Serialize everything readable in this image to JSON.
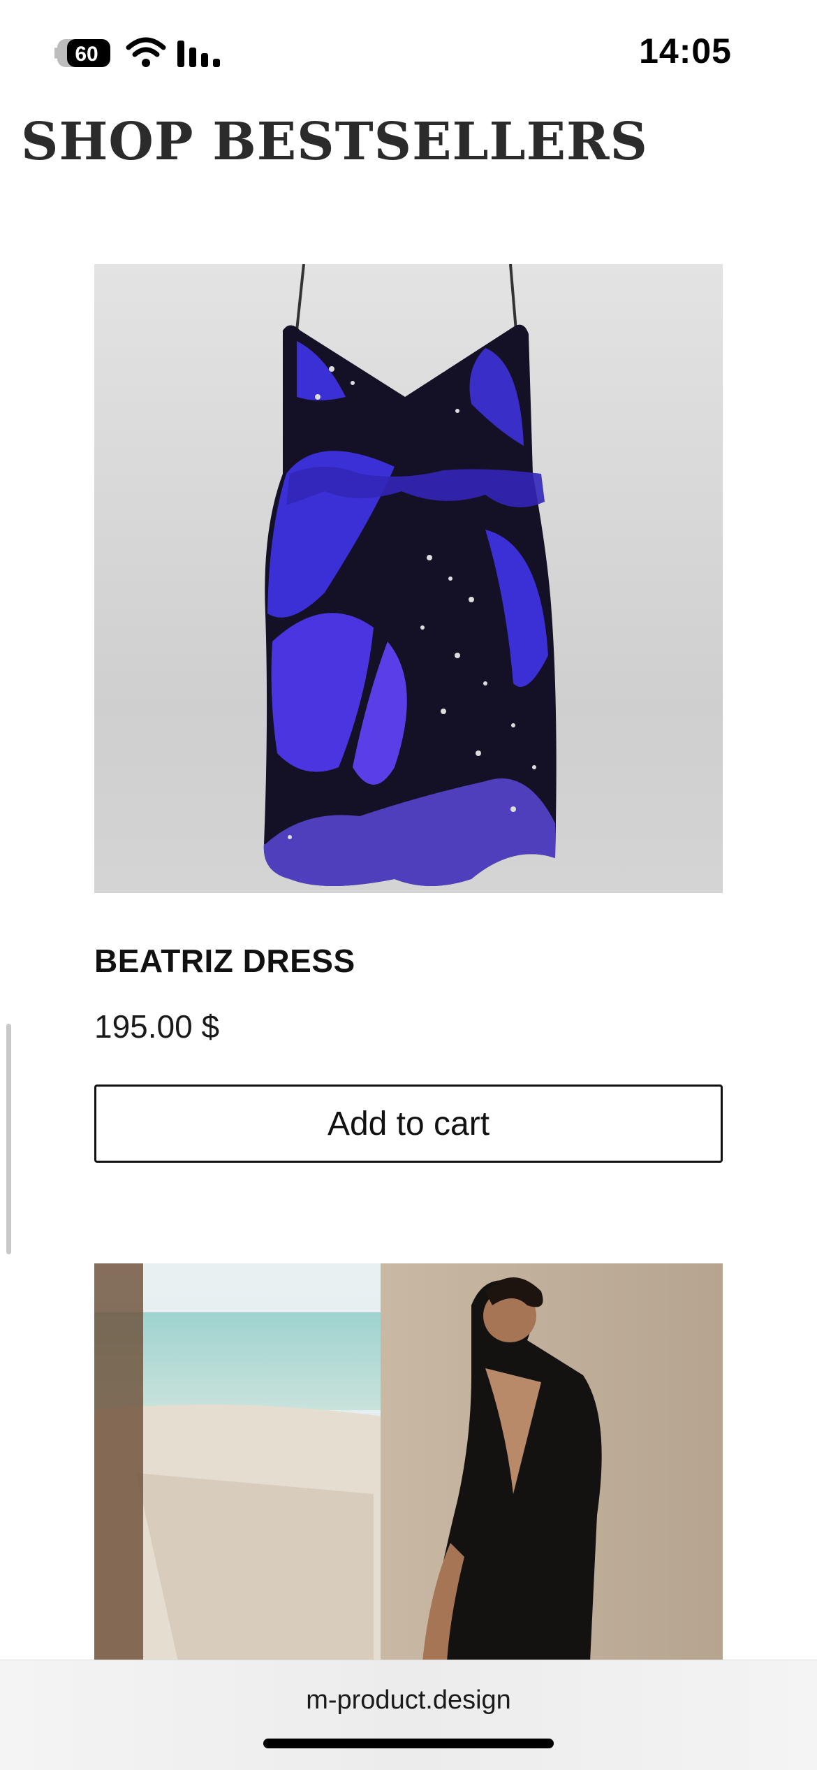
{
  "status_bar": {
    "time": "14:05",
    "battery_level": "60"
  },
  "page": {
    "title": "SHOP BESTSELLERS"
  },
  "products": [
    {
      "name": "BEATRIZ DRESS",
      "price": "195.00 $",
      "cta_label": "Add to cart",
      "image_icon": "dress-photo"
    },
    {
      "image_icon": "model-photo"
    }
  ],
  "browser": {
    "url": "m-product.design"
  },
  "colors": {
    "dress_primary": "#3b2fd6",
    "dress_dark": "#141026",
    "image_background": "#d8d8d8",
    "button_border": "#111111"
  }
}
